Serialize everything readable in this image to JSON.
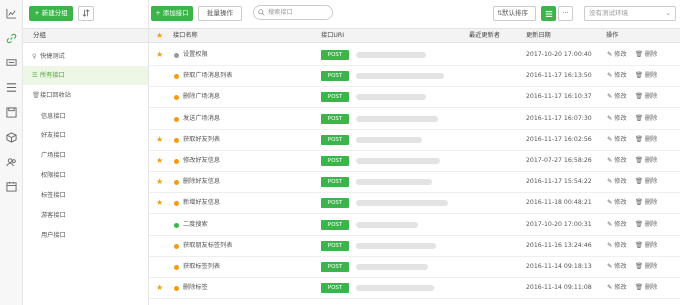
{
  "colors": {
    "accent": "#3bb54a",
    "dot_gray": "#999999",
    "dot_orange": "#f39c12",
    "dot_green": "#3bb54a",
    "star": "#f39c12"
  },
  "rail": {
    "icons": [
      "chart-icon",
      "link-icon",
      "api-icon",
      "list-icon",
      "save-icon",
      "cube-icon",
      "users-icon",
      "calendar-icon"
    ]
  },
  "left_panel": {
    "new_group_label": "+ 新建分组",
    "header": "分组",
    "items": [
      {
        "label": "快捷测试",
        "icon": "lightbulb-icon"
      },
      {
        "label": "所有接口",
        "icon": "list-icon",
        "active": true
      },
      {
        "label": "接口回收站",
        "icon": "trash-icon"
      }
    ],
    "subgroups": [
      "信息接口",
      "好友接口",
      "广场接口",
      "权限接口",
      "标签接口",
      "游客接口",
      "用户接口"
    ]
  },
  "toolbar": {
    "add_api_label": "+ 添加接口",
    "batch_label": "批量操作",
    "search_placeholder": "搜索接口",
    "default_sort_label": "默认排序",
    "env_placeholder": "没有测试环境"
  },
  "table": {
    "columns": [
      "接口名称",
      "接口URI",
      "最近更新者",
      "更新日期",
      "操作"
    ],
    "edit_label": "修改",
    "delete_label": "删除",
    "rows": [
      {
        "name": "设置权限",
        "method": "POST",
        "date": "2017-10-20 17:00:40",
        "starred": true,
        "dot": "gray"
      },
      {
        "name": "获取广场消息列表",
        "method": "POST",
        "date": "2016-11-17 16:13:50",
        "starred": false,
        "dot": "orange"
      },
      {
        "name": "删除广场消息",
        "method": "POST",
        "date": "2016-11-17 16:10:37",
        "starred": false,
        "dot": "orange"
      },
      {
        "name": "发送广场消息",
        "method": "POST",
        "date": "2016-11-17 16:07:30",
        "starred": false,
        "dot": "orange"
      },
      {
        "name": "获取好友列表",
        "method": "POST",
        "date": "2016-11-17 16:02:56",
        "starred": true,
        "dot": "orange"
      },
      {
        "name": "修改好友信息",
        "method": "POST",
        "date": "2017-07-27 16:58:26",
        "starred": true,
        "dot": "orange"
      },
      {
        "name": "删除好友信息",
        "method": "POST",
        "date": "2016-11-17 15:54:22",
        "starred": true,
        "dot": "orange"
      },
      {
        "name": "新增好友信息",
        "method": "POST",
        "date": "2016-11-18 00:48:21",
        "starred": true,
        "dot": "orange"
      },
      {
        "name": "二度搜索",
        "method": "POST",
        "date": "2017-10-20 17:00:31",
        "starred": false,
        "dot": "green"
      },
      {
        "name": "获取朋友标签列表",
        "method": "POST",
        "date": "2016-11-16 13:24:46",
        "starred": false,
        "dot": "orange"
      },
      {
        "name": "获取标签列表",
        "method": "POST",
        "date": "2016-11-14 09:18:13",
        "starred": false,
        "dot": "orange"
      },
      {
        "name": "删除标签",
        "method": "POST",
        "date": "2016-11-14 09:11:08",
        "starred": true,
        "dot": "orange"
      }
    ]
  }
}
